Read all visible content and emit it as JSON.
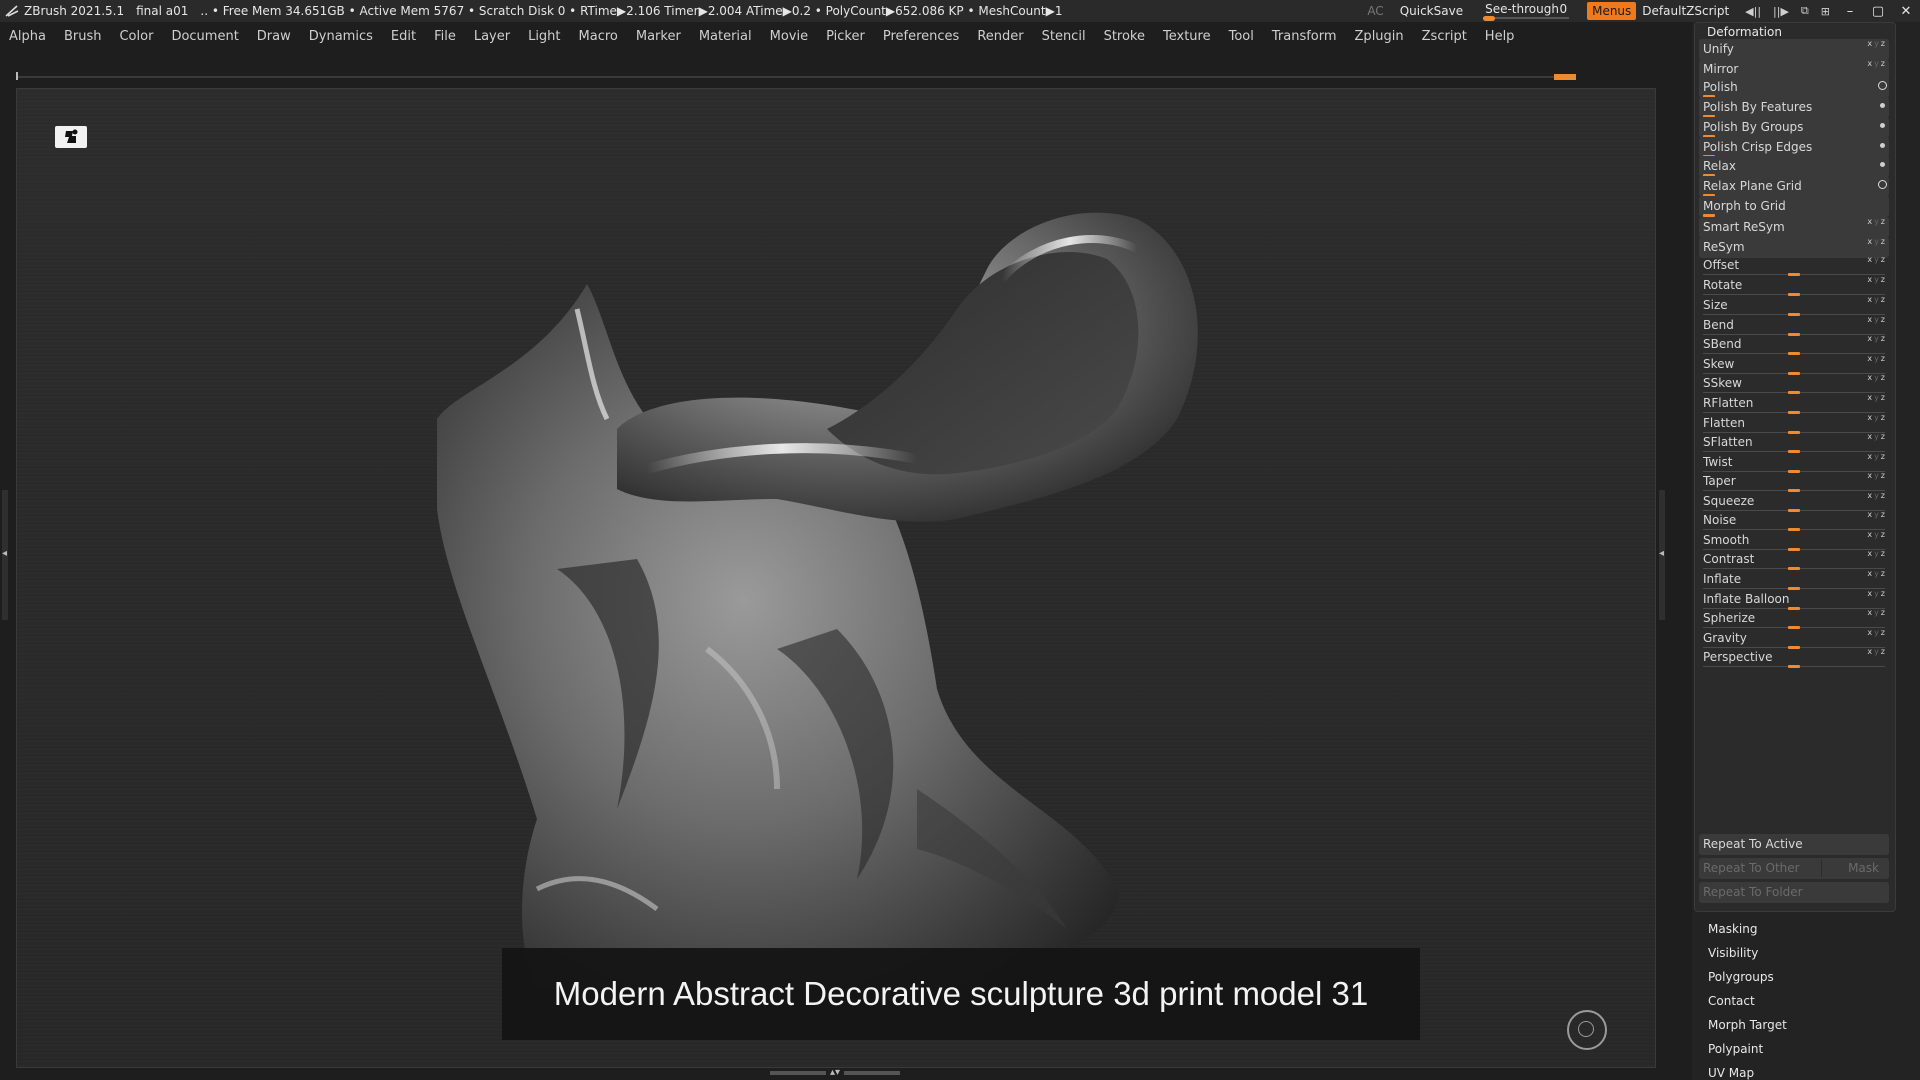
{
  "titlebar": {
    "app": "ZBrush 2021.5.1",
    "document": "final a01",
    "status": ".. • Free Mem 34.651GB • Active Mem 5767 • Scratch Disk 0 •  RTime▶2.106 Timer▶2.004 ATime▶0.2 • PolyCount▶652.086 KP  • MeshCount▶1",
    "ac": "AC",
    "quicksave": "QuickSave",
    "seethrough_label": "See-through",
    "seethrough_value": "0",
    "menus": "Menus",
    "default_zscript": "DefaultZScript",
    "minimize": "–",
    "maximize": "▢",
    "close": "✕"
  },
  "menubar": [
    "Alpha",
    "Brush",
    "Color",
    "Document",
    "Draw",
    "Dynamics",
    "Edit",
    "File",
    "Layer",
    "Light",
    "Macro",
    "Marker",
    "Material",
    "Movie",
    "Picker",
    "Preferences",
    "Render",
    "Stencil",
    "Stroke",
    "Texture",
    "Tool",
    "Transform",
    "Zplugin",
    "Zscript",
    "Help"
  ],
  "canvas": {
    "caption": "Modern Abstract Decorative sculpture 3d print model 31"
  },
  "deformation": {
    "title": "Deformation",
    "rows": [
      {
        "label": "Unify",
        "kind": "button-xyz"
      },
      {
        "label": "Mirror",
        "kind": "button-xyz"
      },
      {
        "label": "Polish",
        "kind": "button-circle"
      },
      {
        "label": "Polish By Features",
        "kind": "button-dot"
      },
      {
        "label": "Polish By Groups",
        "kind": "button-dot"
      },
      {
        "label": "Polish Crisp Edges",
        "kind": "button-dot"
      },
      {
        "label": "Relax",
        "kind": "button-dot"
      },
      {
        "label": "Relax Plane Grid",
        "kind": "button-circle"
      },
      {
        "label": "Morph to Grid",
        "kind": "button-bar"
      },
      {
        "label": "Smart ReSym",
        "kind": "button-xyz"
      },
      {
        "label": "ReSym",
        "kind": "button-xyz"
      },
      {
        "label": "Offset",
        "kind": "slider"
      },
      {
        "label": "Rotate",
        "kind": "slider"
      },
      {
        "label": "Size",
        "kind": "slider"
      },
      {
        "label": "Bend",
        "kind": "slider"
      },
      {
        "label": "SBend",
        "kind": "slider"
      },
      {
        "label": "Skew",
        "kind": "slider"
      },
      {
        "label": "SSkew",
        "kind": "slider"
      },
      {
        "label": "RFlatten",
        "kind": "slider"
      },
      {
        "label": "Flatten",
        "kind": "slider"
      },
      {
        "label": "SFlatten",
        "kind": "slider"
      },
      {
        "label": "Twist",
        "kind": "slider"
      },
      {
        "label": "Taper",
        "kind": "slider"
      },
      {
        "label": "Squeeze",
        "kind": "slider"
      },
      {
        "label": "Noise",
        "kind": "slider"
      },
      {
        "label": "Smooth",
        "kind": "slider"
      },
      {
        "label": "Contrast",
        "kind": "slider"
      },
      {
        "label": "Inflate",
        "kind": "slider"
      },
      {
        "label": "Inflate Balloon",
        "kind": "slider"
      },
      {
        "label": "Spherize",
        "kind": "slider"
      },
      {
        "label": "Gravity",
        "kind": "slider"
      },
      {
        "label": "Perspective",
        "kind": "slider"
      }
    ],
    "repeat_to_active": "Repeat To Active",
    "repeat_to_other": "Repeat To Other",
    "mask": "Mask",
    "repeat_to_folder": "Repeat To Folder"
  },
  "tool_subpalettes": [
    "Masking",
    "Visibility",
    "Polygroups",
    "Contact",
    "Morph Target",
    "Polypaint",
    "UV Map"
  ],
  "colors": {
    "accent": "#ef8a2f",
    "menus_button": "#ef7a1e"
  }
}
